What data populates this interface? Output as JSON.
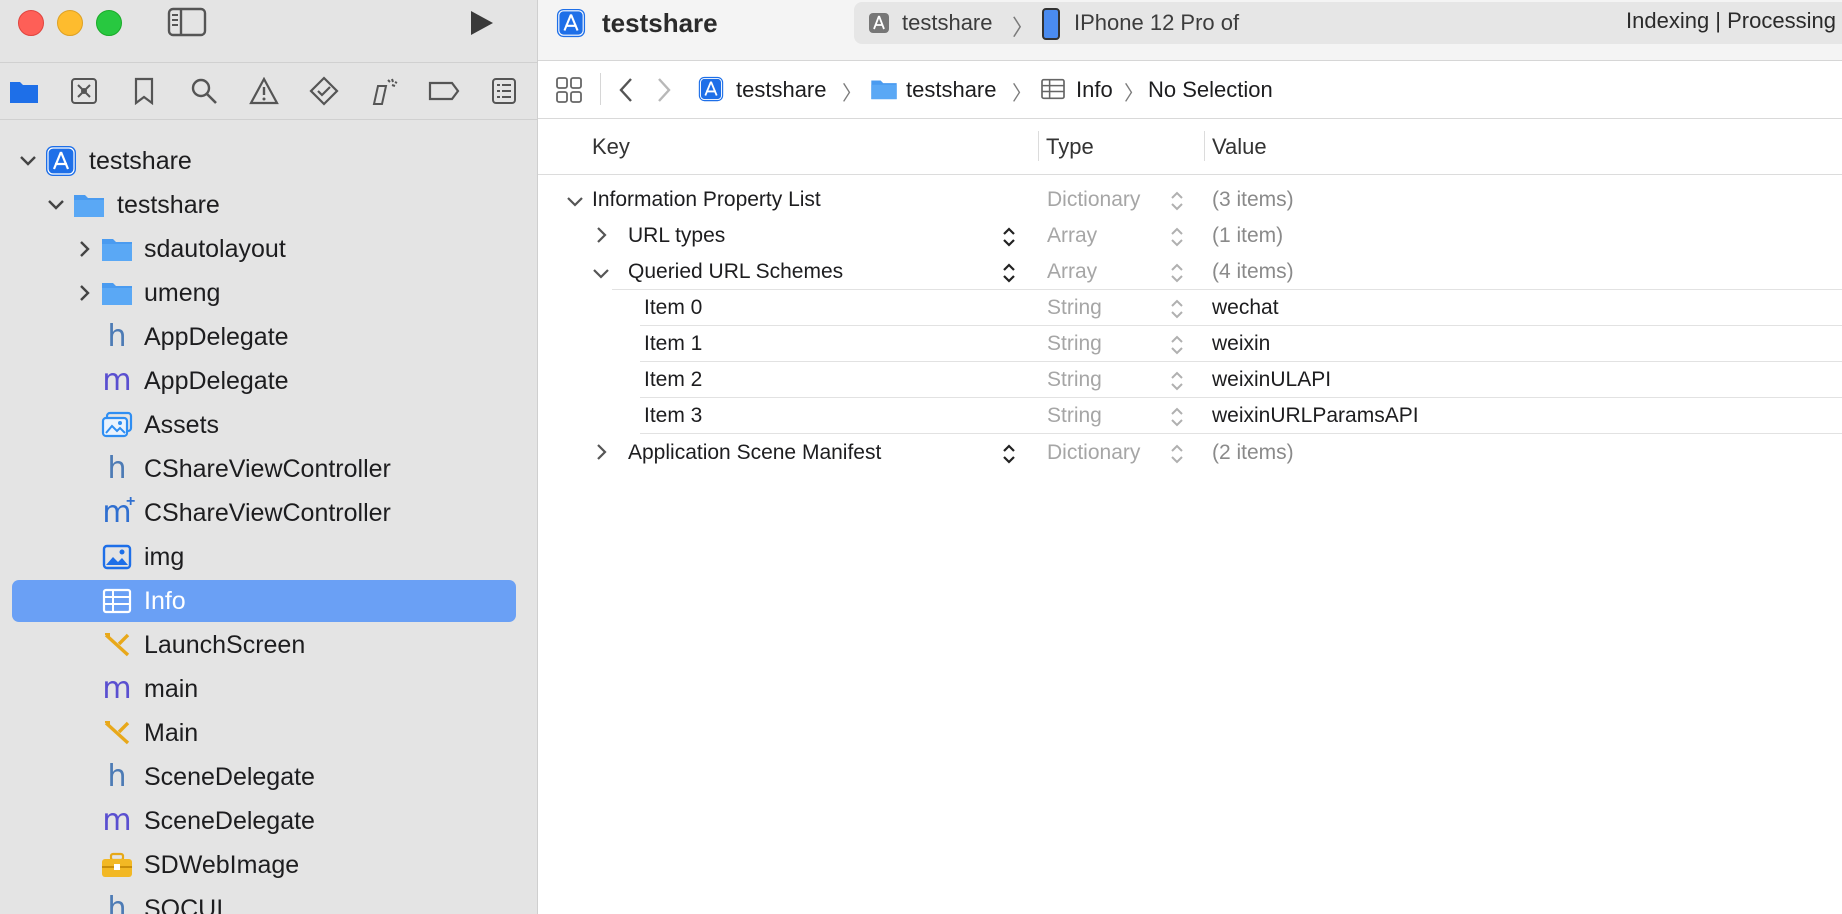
{
  "window": {
    "project_title": "testshare"
  },
  "toolbar": {
    "scheme": "testshare",
    "device": "IPhone 12 Pro of",
    "activity": "Indexing | Processing"
  },
  "jumpbar": {
    "items": [
      "testshare",
      "testshare",
      "Info",
      "No Selection"
    ]
  },
  "navigator": {
    "tree": [
      {
        "label": "testshare",
        "icon": "app-project-icon"
      },
      {
        "label": "testshare",
        "icon": "folder-icon"
      },
      {
        "label": "sdautolayout",
        "icon": "folder-icon"
      },
      {
        "label": "umeng",
        "icon": "folder-icon"
      },
      {
        "label": "AppDelegate",
        "icon": "header-file-icon"
      },
      {
        "label": "AppDelegate",
        "icon": "objc-file-icon"
      },
      {
        "label": "Assets",
        "icon": "asset-catalog-icon"
      },
      {
        "label": "CShareViewController",
        "icon": "header-file-icon"
      },
      {
        "label": "CShareViewController",
        "icon": "objcpp-file-icon"
      },
      {
        "label": "img",
        "icon": "image-icon"
      },
      {
        "label": "Info",
        "icon": "plist-icon"
      },
      {
        "label": "LaunchScreen",
        "icon": "storyboard-icon"
      },
      {
        "label": "main",
        "icon": "objc-file-icon"
      },
      {
        "label": "Main",
        "icon": "storyboard-icon"
      },
      {
        "label": "SceneDelegate",
        "icon": "header-file-icon"
      },
      {
        "label": "SceneDelegate",
        "icon": "objc-file-icon"
      },
      {
        "label": "SDWebImage",
        "icon": "framework-folder-icon"
      },
      {
        "label": "SOCUI",
        "icon": "header-file-icon"
      }
    ],
    "glyphs": {
      "h": "h",
      "m": "m",
      "m_plus": "+"
    }
  },
  "plist": {
    "headers": {
      "key": "Key",
      "type": "Type",
      "value": "Value"
    },
    "rows": [
      {
        "key": "Information Property List",
        "type": "Dictionary",
        "value": "(3 items)"
      },
      {
        "key": "URL types",
        "type": "Array",
        "value": "(1 item)"
      },
      {
        "key": "Queried URL Schemes",
        "type": "Array",
        "value": "(4 items)"
      },
      {
        "key": "Item 0",
        "type": "String",
        "value": "wechat"
      },
      {
        "key": "Item 1",
        "type": "String",
        "value": "weixin"
      },
      {
        "key": "Item 2",
        "type": "String",
        "value": "weixinULAPI"
      },
      {
        "key": "Item 3",
        "type": "String",
        "value": "weixinURLParamsAPI"
      },
      {
        "key": "Application Scene Manifest",
        "type": "Dictionary",
        "value": "(2 items)"
      }
    ]
  },
  "colors": {
    "selection": "#6aa0f5",
    "folder": "#4a9bf0",
    "accent": "#1e6fe8"
  }
}
